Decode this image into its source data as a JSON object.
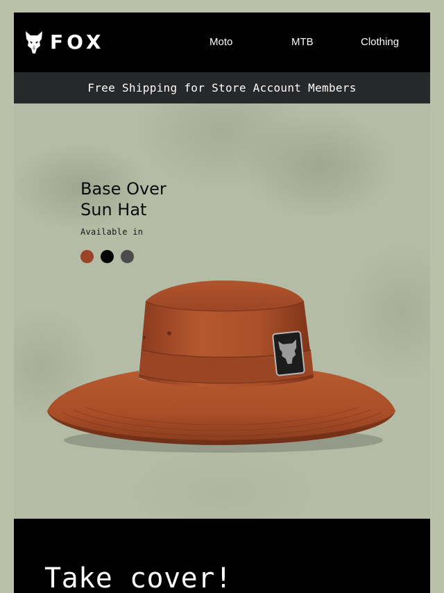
{
  "header": {
    "logo_text": "FOX",
    "logo_icon": "fox-head-icon",
    "nav": [
      {
        "label": "Moto"
      },
      {
        "label": "MTB"
      },
      {
        "label": "Clothing"
      }
    ]
  },
  "banner": {
    "text": "Free Shipping for Store Account Members"
  },
  "product": {
    "title_line1": "Base Over",
    "title_line2": "Sun Hat",
    "availability_label": "Available in",
    "colors": [
      "#9a4329",
      "#050505",
      "#4a4b4a"
    ],
    "image_icon": "bucket-hat-image"
  },
  "promo": {
    "headline": "Take cover!"
  }
}
